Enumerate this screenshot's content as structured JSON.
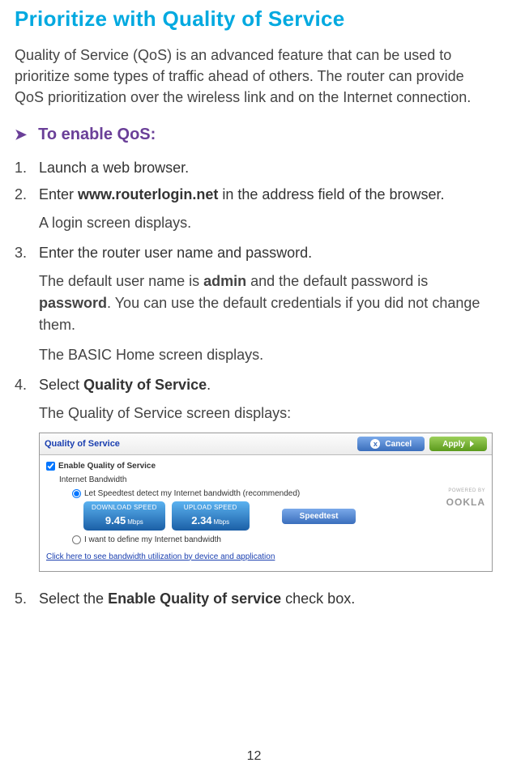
{
  "title": "Prioritize with Quality of Service",
  "intro": "Quality of Service (QoS) is an advanced feature that can be used to prioritize some types of traffic ahead of others. The router can provide QoS prioritization over the wireless link and on the Internet connection.",
  "subheading_arrow": "➤",
  "subheading": "To enable QoS:",
  "steps": {
    "s1": "Launch a web browser.",
    "s2_prefix": "Enter ",
    "s2_bold": "www.routerlogin.net",
    "s2_suffix": " in the address field of the browser.",
    "s2_sub": "A login screen displays.",
    "s3": "Enter the router user name and password.",
    "s3_sub_a_prefix": "The default user name is ",
    "s3_sub_a_bold1": "admin",
    "s3_sub_a_mid": " and the default password is ",
    "s3_sub_a_bold2": "password",
    "s3_sub_a_suffix": ". You can use the default credentials if you did not change them.",
    "s3_sub_b": "The BASIC Home screen displays.",
    "s4_prefix": "Select ",
    "s4_bold": "Quality of Service",
    "s4_suffix": ".",
    "s4_sub": "The Quality of Service screen displays:",
    "s5_prefix": "Select the ",
    "s5_bold": "Enable Quality of service",
    "s5_suffix": " check box."
  },
  "ui": {
    "header_title": "Quality of Service",
    "btn_cancel": "Cancel",
    "btn_apply": "Apply",
    "checkbox_main": "Enable Quality of Service",
    "ib_label": "Internet Bandwidth",
    "radio_detect": "Let Speedtest detect my Internet bandwidth (recommended)",
    "radio_define": "I want to define my Internet bandwidth",
    "download_label": "DOWNLOAD SPEED",
    "download_value": "9.45",
    "download_unit": "Mbps",
    "upload_label": "UPLOAD SPEED",
    "upload_value": "2.34",
    "upload_unit": "Mbps",
    "btn_speedtest": "Speedtest",
    "link_text": "Click here to see bandwidth utilization by device and application",
    "powered_by": "POWERED BY",
    "ookla": "OOKLA"
  },
  "page_number": "12"
}
